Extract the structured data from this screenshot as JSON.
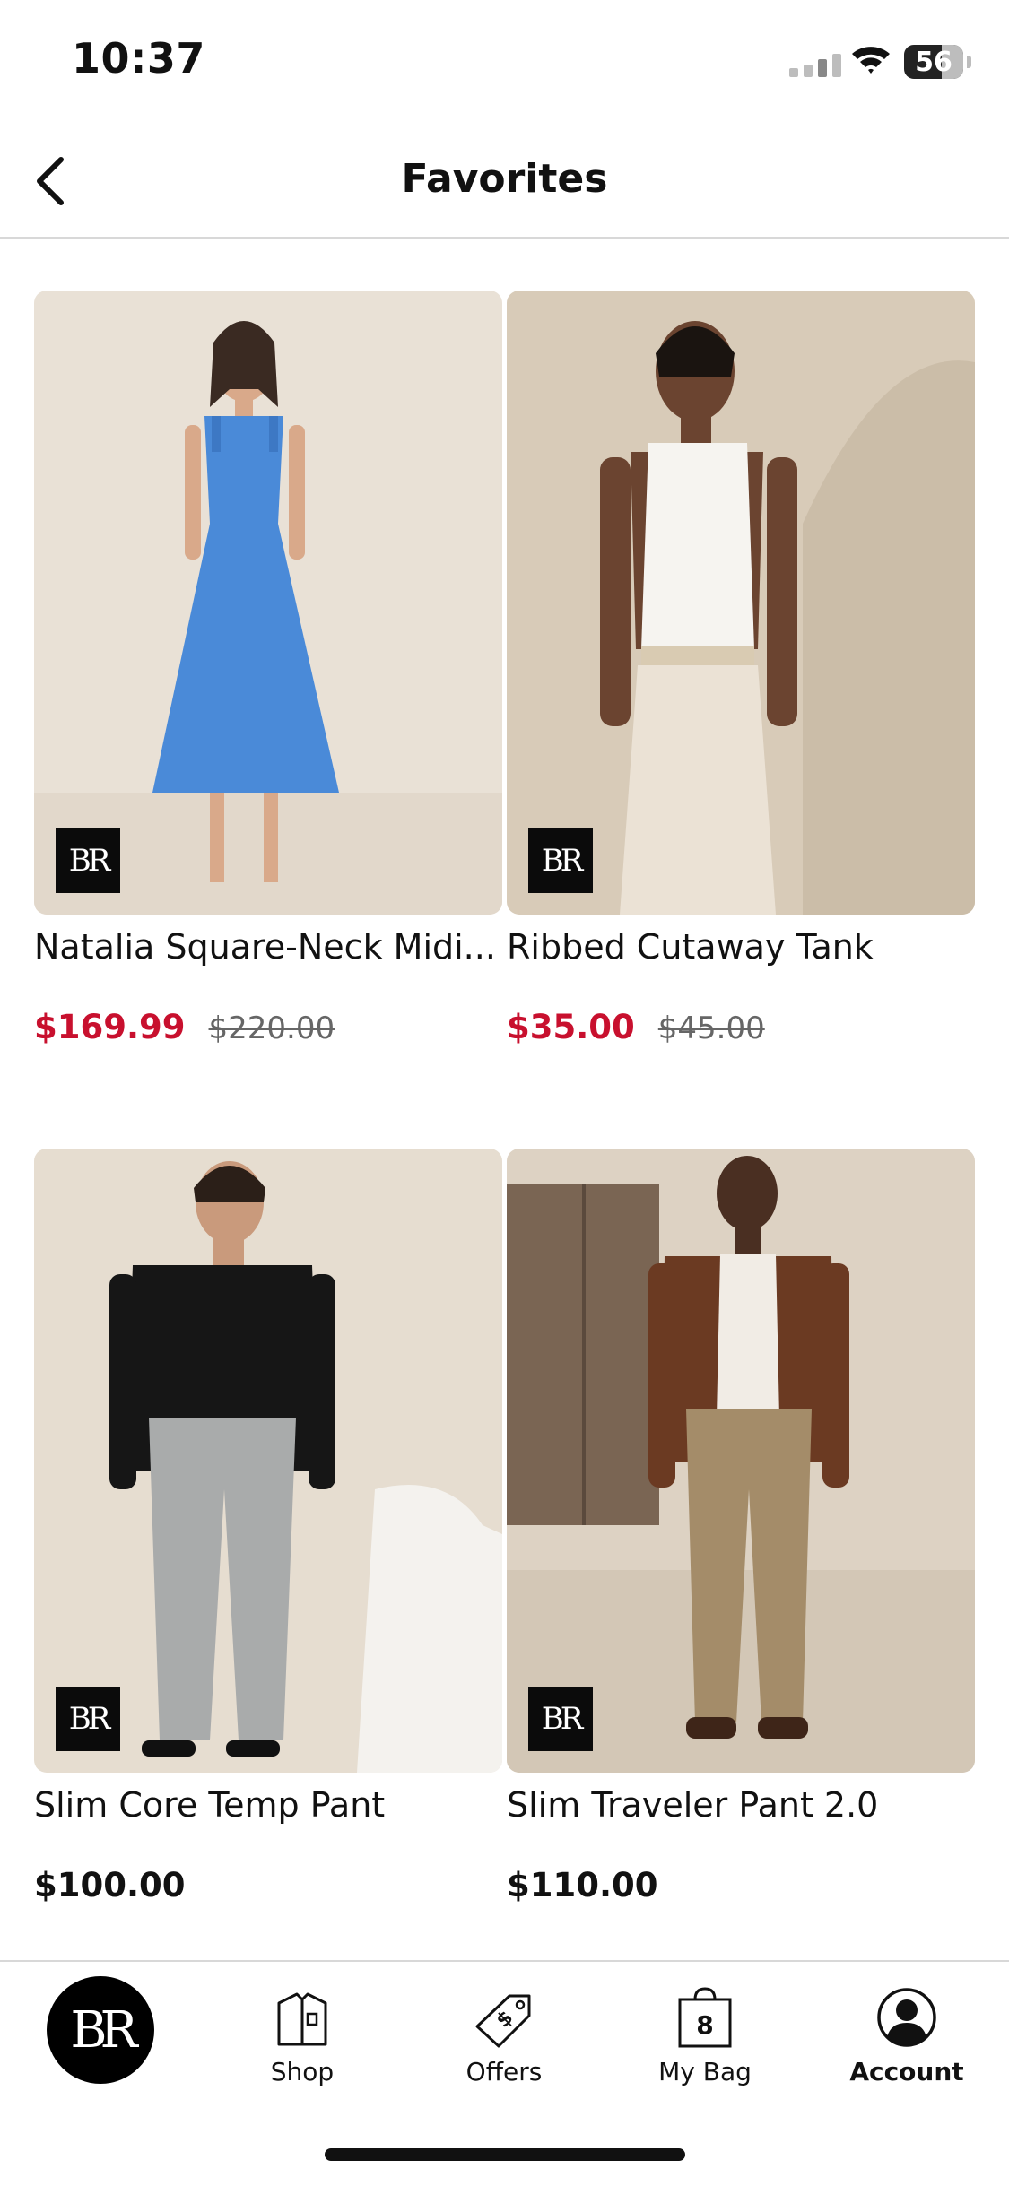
{
  "status_bar": {
    "time": "10:37",
    "battery_level": "56"
  },
  "header": {
    "title": "Favorites"
  },
  "brand_badge": "BR",
  "products": [
    {
      "name": "Natalia Square-Neck Midi...",
      "sale_price": "$169.99",
      "original_price": "$220.00"
    },
    {
      "name": "Ribbed Cutaway Tank",
      "sale_price": "$35.00",
      "original_price": "$45.00"
    },
    {
      "name": "Slim Core Temp Pant",
      "price": "$100.00"
    },
    {
      "name": "Slim Traveler Pant 2.0",
      "price": "$110.00"
    }
  ],
  "tab_bar": {
    "home_logo": "BR",
    "items": [
      {
        "label": "Shop",
        "icon": "shirt-icon"
      },
      {
        "label": "Offers",
        "icon": "price-tag-icon"
      },
      {
        "label": "My Bag",
        "icon": "shopping-bag-icon",
        "badge": "8"
      },
      {
        "label": "Account",
        "icon": "account-icon"
      }
    ]
  },
  "colors": {
    "sale": "#c8102e",
    "text": "#111111",
    "divider": "#d8d8d8"
  }
}
